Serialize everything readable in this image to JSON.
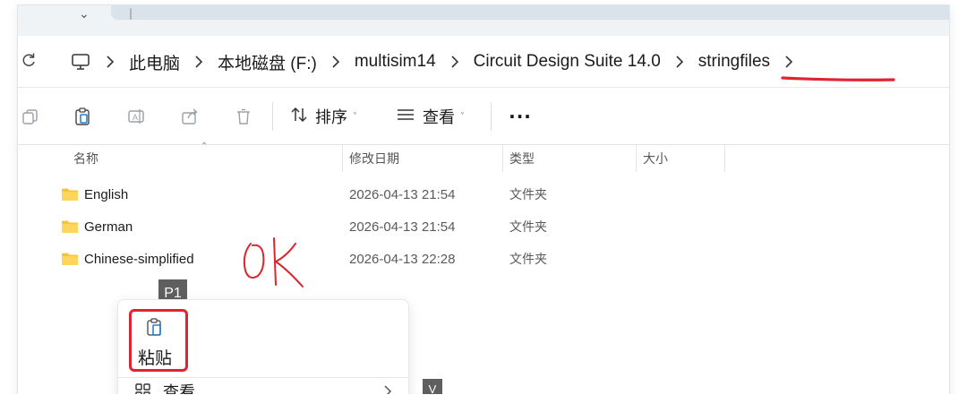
{
  "address_bar": {
    "breadcrumbs": [
      "此电脑",
      "本地磁盘 (F:)",
      "multisim14",
      "Circuit Design Suite 14.0",
      "stringfiles"
    ]
  },
  "command_bar": {
    "sort_label": "排序",
    "view_label": "查看",
    "more_label": "···"
  },
  "file_list": {
    "columns": [
      "名称",
      "修改日期",
      "类型",
      "大小"
    ],
    "rows": [
      {
        "name": "English",
        "modified": "2026-04-13 21:54",
        "type": "文件夹",
        "size": ""
      },
      {
        "name": "German",
        "modified": "2026-04-13 21:54",
        "type": "文件夹",
        "size": ""
      },
      {
        "name": "Chinese-simplified",
        "modified": "2026-04-13 22:28",
        "type": "文件夹",
        "size": ""
      }
    ]
  },
  "annotation": {
    "handwriting_text": "ok",
    "highlight_color": "#e0242f"
  },
  "tags": {
    "p1": "P1",
    "v": "V"
  },
  "context_menu": {
    "paste_label": "粘贴",
    "view_label": "查看"
  },
  "colors": {
    "folder": "#f5c342",
    "accent": "#0067c0"
  }
}
